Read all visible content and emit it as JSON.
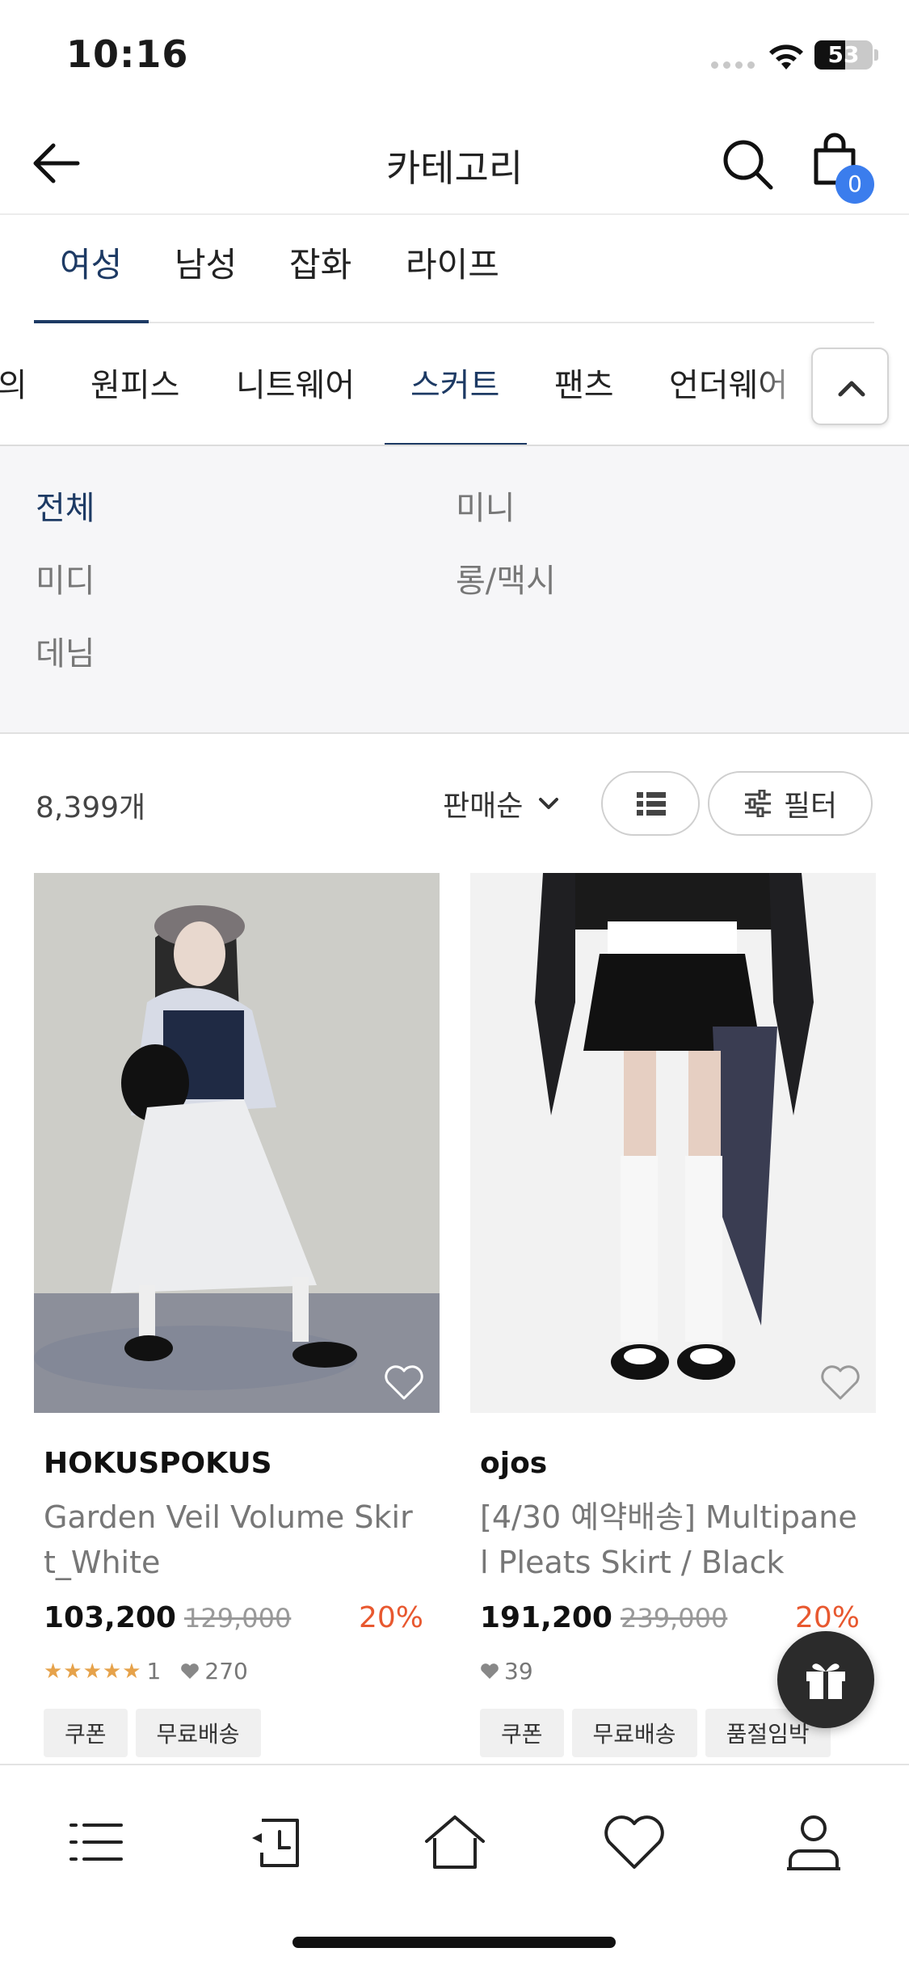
{
  "status_bar": {
    "time": "10:16",
    "battery_level": "53",
    "battery_fraction": 0.53
  },
  "header": {
    "title": "카테고리",
    "cart_count": "0"
  },
  "gender_tabs": [
    {
      "label": "여성",
      "active": true
    },
    {
      "label": "남성",
      "active": false
    },
    {
      "label": "잡화",
      "active": false
    },
    {
      "label": "라이프",
      "active": false
    }
  ],
  "category_tabs": [
    {
      "label": "상의",
      "active": false
    },
    {
      "label": "원피스",
      "active": false
    },
    {
      "label": "니트웨어",
      "active": false
    },
    {
      "label": "스커트",
      "active": true
    },
    {
      "label": "팬츠",
      "active": false
    },
    {
      "label": "언더웨어",
      "active": false
    }
  ],
  "subcategories": [
    {
      "label": "전체",
      "active": true
    },
    {
      "label": "미니",
      "active": false
    },
    {
      "label": "미디",
      "active": false
    },
    {
      "label": "롱/맥시",
      "active": false
    },
    {
      "label": "데님",
      "active": false
    }
  ],
  "toolbar": {
    "count": "8,399개",
    "sort_label": "판매순",
    "filter_label": "필터"
  },
  "products": [
    {
      "brand": "HOKUSPOKUS",
      "name": "Garden Veil Volume Skirt_White",
      "price": "103,200",
      "original_price": "129,000",
      "discount": "20%",
      "stars": "★★★★★",
      "review_count": "1",
      "likes": "270",
      "tags": [
        "쿠폰",
        "무료배송"
      ]
    },
    {
      "brand": "ojos",
      "name": "[4/30 예약배송] Multipanel Pleats Skirt / Black",
      "price": "191,200",
      "original_price": "239,000",
      "discount": "20%",
      "likes": "39",
      "tags": [
        "쿠폰",
        "무료배송",
        "품절임박"
      ]
    }
  ],
  "colors": {
    "accent_navy": "#1d3a64",
    "badge_blue": "#3b7ded",
    "discount_orange": "#e8582f",
    "star_gold": "#e6a24a"
  },
  "icons": [
    "back-arrow-icon",
    "search-icon",
    "shopping-bag-icon",
    "chevron-up-icon",
    "chevron-down-icon",
    "list-view-icon",
    "filter-sliders-icon",
    "heart-icon",
    "gift-icon",
    "menu-icon",
    "recent-icon",
    "home-icon",
    "user-icon"
  ]
}
